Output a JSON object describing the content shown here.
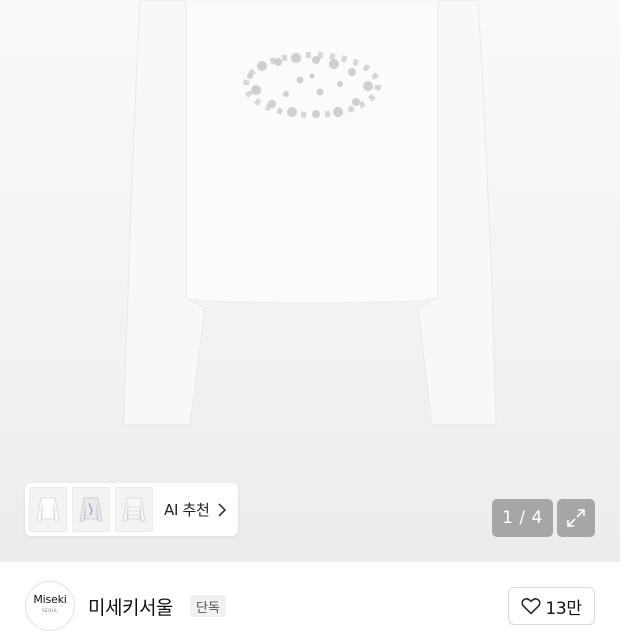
{
  "gallery": {
    "current_page": "1",
    "total_pages": "4",
    "counter_text": "1 / 4"
  },
  "ai_recommend": {
    "label": "AI 추천",
    "thumbnails": [
      "white-long-sleeve-top",
      "grey-print-top",
      "white-lace-top"
    ]
  },
  "brand": {
    "logo_text": "Miseki",
    "logo_subtext": "SEOUL",
    "name": "미세키서울",
    "badge": "단독"
  },
  "like": {
    "count": "13만"
  },
  "icons": {
    "expand": "expand-arrows-icon",
    "chevron": "chevron-right-icon",
    "heart": "heart-icon"
  },
  "colors": {
    "background_hero": "#f2f2f2",
    "overlay_pill": "#969696"
  }
}
